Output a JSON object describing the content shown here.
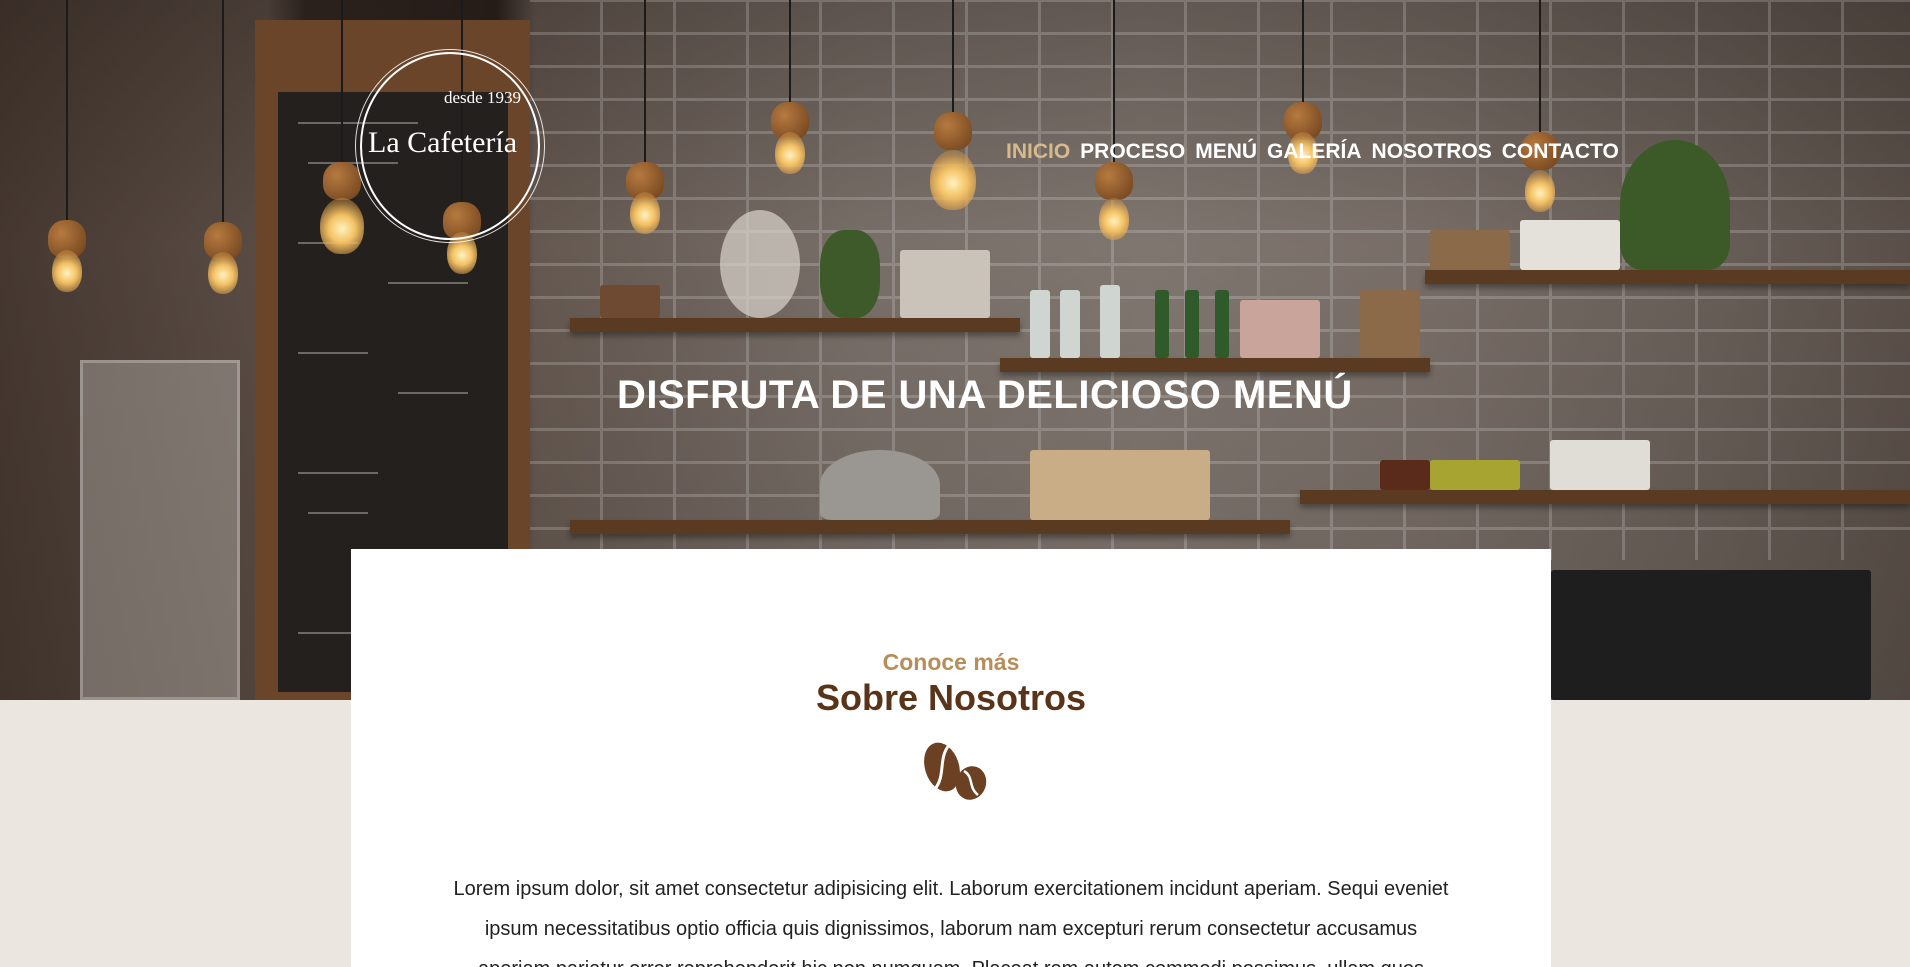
{
  "brand": {
    "since": "desde 1939",
    "name": "La Cafetería"
  },
  "nav": {
    "items": [
      "INICIO",
      "PROCESO",
      "MENÚ",
      "GALERÍA",
      "NOSOTROS",
      "CONTACTO"
    ],
    "active_index": 0
  },
  "hero": {
    "title": "DISFRUTA DE UNA DELICIOSO MENÚ"
  },
  "about": {
    "kicker": "Conoce más",
    "title": "Sobre Nosotros",
    "icon": "coffee-beans-icon",
    "text": "Lorem ipsum dolor, sit amet consectetur adipisicing elit. Laborum exercitationem incidunt aperiam. Sequi eveniet ipsum necessitatibus optio officia quis dignissimos, laborum nam excepturi rerum consectetur accusamus aperiam pariatur error reprehenderit hic non numquam. Placeat rem autem commodi possimus, ullam quos"
  },
  "colors": {
    "accent": "#d7b98d",
    "kicker": "#b78e5a",
    "title_brown": "#5a3418",
    "page_bg": "#ebe6e0"
  }
}
